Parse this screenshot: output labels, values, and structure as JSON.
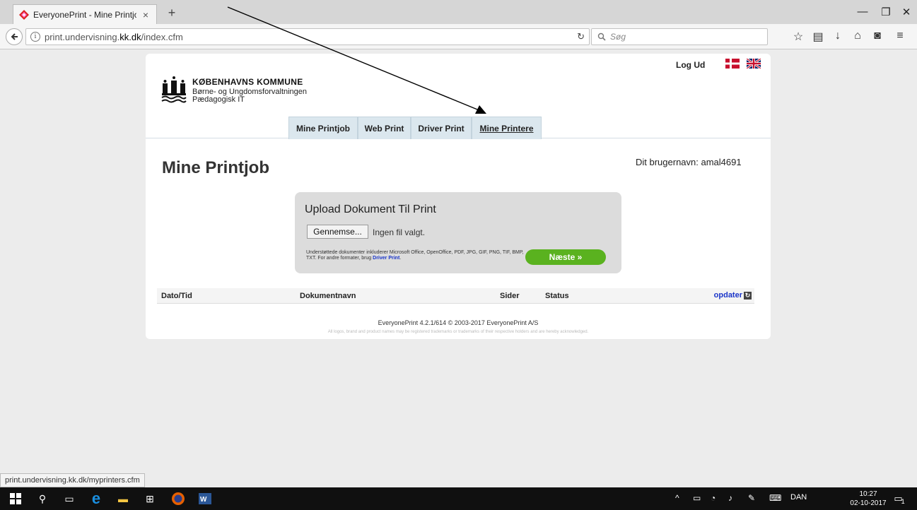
{
  "browser": {
    "tab_title": "EveryonePrint - Mine Printjo",
    "tab_close": "×",
    "new_tab": "+",
    "url_prefix": "print.undervisning.",
    "url_domain": "kk.dk",
    "url_path": "/index.cfm",
    "search_placeholder": "Søg",
    "status_url": "print.undervisning.kk.dk/myprinters.cfm"
  },
  "header": {
    "brand_name": "KØBENHAVNS KOMMUNE",
    "brand_sub1": "Børne- og Ungdomsforvaltningen",
    "brand_sub2": "Pædagogisk IT",
    "logout_label": "Log Ud",
    "tabs": [
      {
        "label": "Mine Printjob"
      },
      {
        "label": "Web Print"
      },
      {
        "label": "Driver Print"
      },
      {
        "label": "Mine Printere"
      }
    ]
  },
  "main": {
    "title": "Mine Printjob",
    "username_line": "Dit brugernavn: amal4691"
  },
  "upload": {
    "title": "Upload Dokument Til Print",
    "browse_label": "Gennemse...",
    "no_file": "Ingen fil valgt.",
    "supported_text": "Understøttede dokumenter inkluderer Microsoft Office, OpenOffice, PDF, JPG, GIF, PNG, TIF, BMP, TXT. For andre formater, brug ",
    "supported_link": "Driver Print",
    "supported_end": ".",
    "next_label": "Næste »"
  },
  "jobs_table": {
    "columns": [
      "Dato/Tid",
      "Dokumentnavn",
      "Sider",
      "Status"
    ],
    "refresh_label": "opdater"
  },
  "footer": {
    "line1": "EveryonePrint 4.2.1/614 © 2003-2017 EveryonePrint A/S",
    "line2": "All logos, brand and product names may be registered trademarks or trademarks of their respective holders and are hereby acknowledged."
  },
  "taskbar": {
    "language": "DAN",
    "time": "10:27",
    "date": "02-10-2017",
    "notification_count": "1"
  },
  "colors": {
    "tab_bg": "#dbe7ee",
    "next_button": "#5ab21f",
    "link": "#1a35c9"
  },
  "icons": [
    "everyoneprint-favicon",
    "back-icon",
    "info-icon",
    "reload-icon",
    "search-icon",
    "star-icon",
    "reading-list-icon",
    "download-icon",
    "home-icon",
    "pocket-icon",
    "menu-icon",
    "danish-flag-icon",
    "uk-flag-icon",
    "refresh-icon",
    "windows-start-icon",
    "search-icon",
    "task-view-icon",
    "edge-icon",
    "file-explorer-icon",
    "store-icon",
    "firefox-icon",
    "word-icon",
    "battery-icon",
    "wifi-icon",
    "volume-icon",
    "pen-icon",
    "keyboard-icon",
    "notifications-icon"
  ]
}
